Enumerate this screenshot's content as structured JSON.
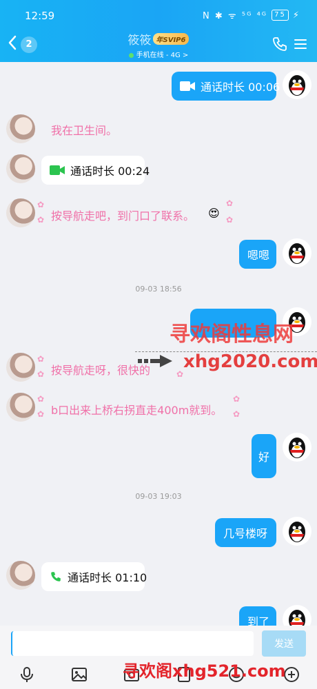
{
  "status_bar": {
    "time": "12:59",
    "icons": "N ✱ ᯤ ⁵ᴳ ⁴ᴳ",
    "battery": "75"
  },
  "header": {
    "unread_count": "2",
    "contact_name": "筱筱",
    "vip_badge": "年SVIP6",
    "online_status": "手机在线 - 4G >"
  },
  "messages": {
    "m1": "通话时长 00:06",
    "m2": "我在卫生间。",
    "m3": "通话时长 00:24",
    "m4": "按导航走吧，到门口了联系。",
    "m5": "嗯嗯",
    "ts1": "09-03 18:56",
    "m6": "",
    "m7": "按导航走呀，很快的",
    "m8": "b口出来上桥右拐直走400m就到。",
    "m9": "好",
    "ts2": "09-03 19:03",
    "m10": "几号楼呀",
    "m11": "通话时长 01:10",
    "m12": "到了"
  },
  "input": {
    "placeholder": "",
    "send_label": "发送"
  },
  "watermarks": {
    "w1": "寻欢阁性息网",
    "w2": "xhg2020.com",
    "w3": "寻欢阁xhg521.com"
  },
  "colors": {
    "header": "#1aa5f5",
    "my_bubble": "#1aa5f8",
    "their_text": "#f070a8"
  }
}
